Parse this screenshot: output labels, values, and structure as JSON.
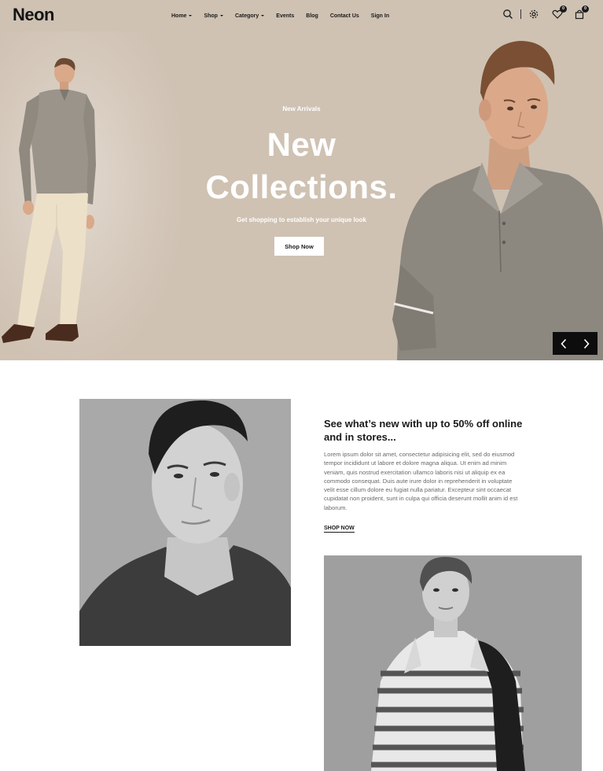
{
  "header": {
    "logo": "Neon",
    "nav": [
      {
        "label": "Home",
        "has_dropdown": true
      },
      {
        "label": "Shop",
        "has_dropdown": true
      },
      {
        "label": "Category",
        "has_dropdown": true
      },
      {
        "label": "Events",
        "has_dropdown": false
      },
      {
        "label": "Blog",
        "has_dropdown": false
      },
      {
        "label": "Contact Us",
        "has_dropdown": false
      },
      {
        "label": "Sign In",
        "has_dropdown": false
      }
    ],
    "icons": [
      "search-icon",
      "settings-icon",
      "heart-icon",
      "bag-icon"
    ],
    "wishlist_count": "0",
    "cart_count": "0"
  },
  "hero": {
    "eyebrow": "New Arrivals",
    "title_line1": "New",
    "title_line2": "Collections.",
    "subtitle": "Get shopping to establish your unique look",
    "button": "Shop Now",
    "background_color": "#cfc2b3"
  },
  "feature": {
    "title": "See what’s new with up to 50% off online and in stores...",
    "body": "Lorem ipsum dolor sit amet, consectetur adipisicing elit, sed do eiusmod tempor incididunt ut labore et dolore magna aliqua. Ut enim ad minim veniam, quis nostrud exercitation ullamco laboris nisi ut aliquip ex ea commodo consequat. Duis aute irure dolor in reprehenderit in voluptate velit esse cillum dolore eu fugiat nulla pariatur. Excepteur sint occaecat cupidatat non proident, sunt in culpa qui officia deserunt mollit anim id est laborum.",
    "link": "SHOP NOW"
  }
}
